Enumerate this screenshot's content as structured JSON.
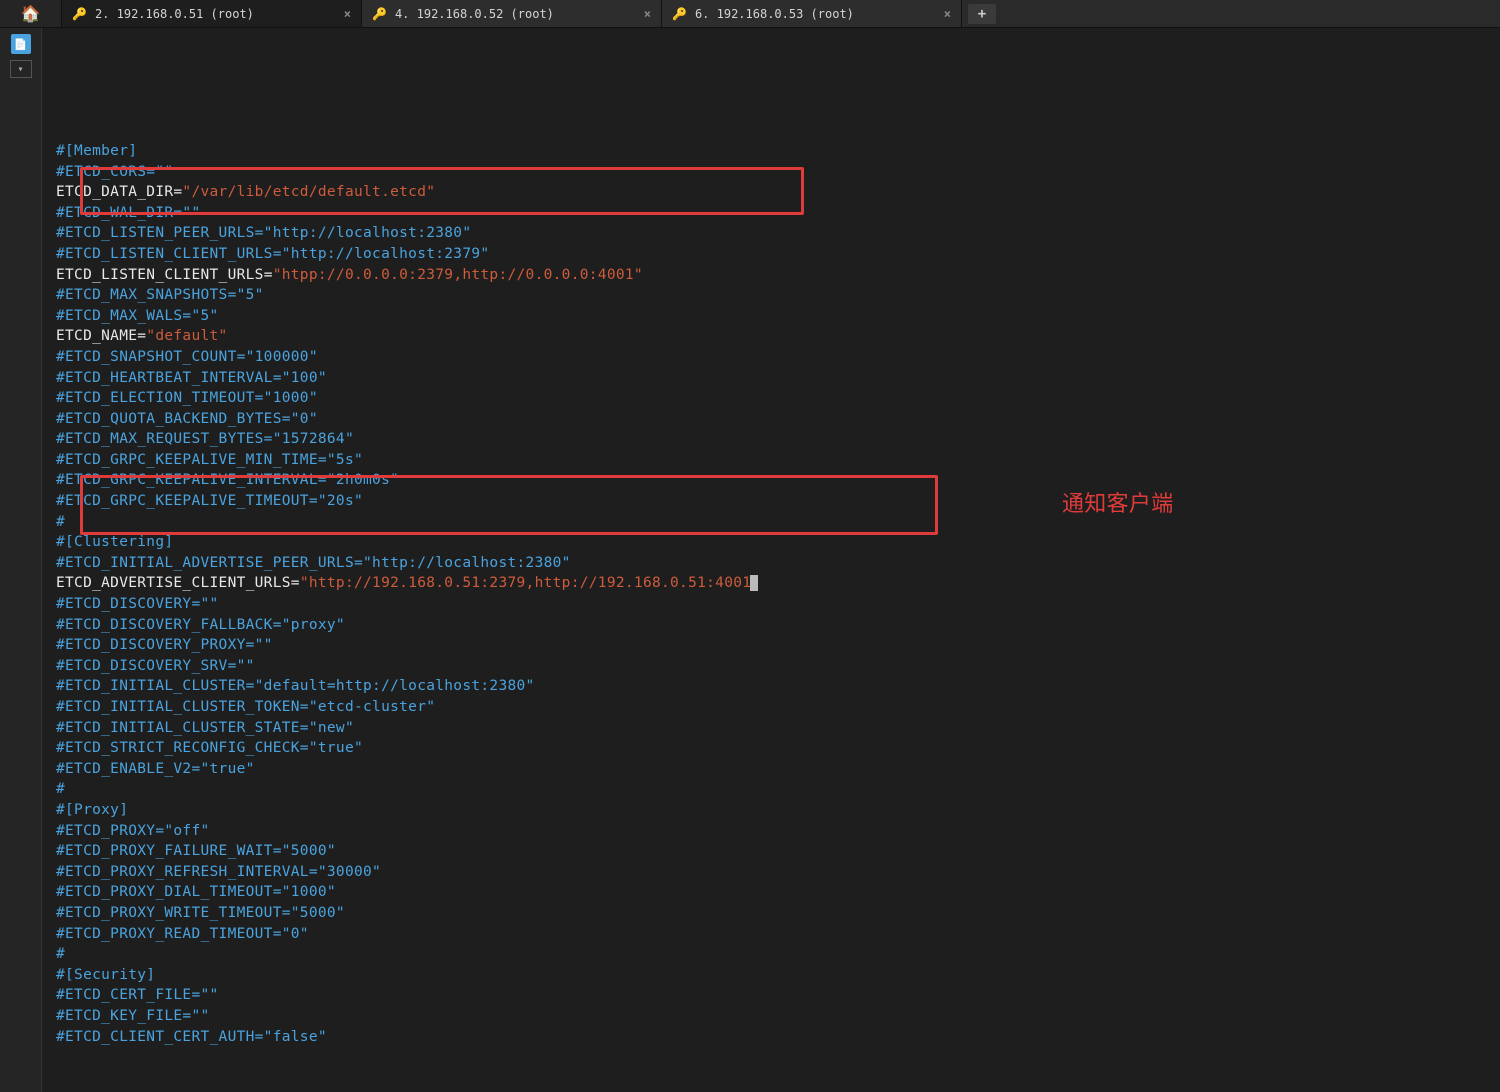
{
  "tabs": [
    {
      "label": "2. 192.168.0.51 (root)",
      "active": true
    },
    {
      "label": "4. 192.168.0.52 (root)",
      "active": false
    },
    {
      "label": "6. 192.168.0.53 (root)",
      "active": false
    }
  ],
  "annotation": "通知客户端",
  "lines": [
    {
      "type": "comment",
      "text": "#[Member]"
    },
    {
      "type": "comment",
      "text": "#ETCD_CORS=\"\""
    },
    {
      "type": "kv",
      "key": "ETCD_DATA_DIR",
      "value": "\"/var/lib/etcd/default.etcd\""
    },
    {
      "type": "comment",
      "text": "#ETCD_WAL_DIR=\"\""
    },
    {
      "type": "comment",
      "text": "#ETCD_LISTEN_PEER_URLS=\"http://localhost:2380\""
    },
    {
      "type": "comment",
      "text": "#ETCD_LISTEN_CLIENT_URLS=\"http://localhost:2379\""
    },
    {
      "type": "kv",
      "key": "ETCD_LISTEN_CLIENT_URLS",
      "value": "\"htpp://0.0.0.0:2379,http://0.0.0.0:4001\""
    },
    {
      "type": "comment",
      "text": "#ETCD_MAX_SNAPSHOTS=\"5\""
    },
    {
      "type": "comment",
      "text": "#ETCD_MAX_WALS=\"5\""
    },
    {
      "type": "kv",
      "key": "ETCD_NAME",
      "value": "\"default\""
    },
    {
      "type": "comment",
      "text": "#ETCD_SNAPSHOT_COUNT=\"100000\""
    },
    {
      "type": "comment",
      "text": "#ETCD_HEARTBEAT_INTERVAL=\"100\""
    },
    {
      "type": "comment",
      "text": "#ETCD_ELECTION_TIMEOUT=\"1000\""
    },
    {
      "type": "comment",
      "text": "#ETCD_QUOTA_BACKEND_BYTES=\"0\""
    },
    {
      "type": "comment",
      "text": "#ETCD_MAX_REQUEST_BYTES=\"1572864\""
    },
    {
      "type": "comment",
      "text": "#ETCD_GRPC_KEEPALIVE_MIN_TIME=\"5s\""
    },
    {
      "type": "comment",
      "text": "#ETCD_GRPC_KEEPALIVE_INTERVAL=\"2h0m0s\""
    },
    {
      "type": "comment",
      "text": "#ETCD_GRPC_KEEPALIVE_TIMEOUT=\"20s\""
    },
    {
      "type": "comment",
      "text": "#"
    },
    {
      "type": "comment",
      "text": "#[Clustering]"
    },
    {
      "type": "comment",
      "text": "#ETCD_INITIAL_ADVERTISE_PEER_URLS=\"http://localhost:2380\""
    },
    {
      "type": "kv_cursor",
      "key": "ETCD_ADVERTISE_CLIENT_URLS",
      "value": "\"http://192.168.0.51:2379,http://192.168.0.51:4001"
    },
    {
      "type": "comment",
      "text": "#ETCD_DISCOVERY=\"\""
    },
    {
      "type": "comment",
      "text": "#ETCD_DISCOVERY_FALLBACK=\"proxy\""
    },
    {
      "type": "comment",
      "text": "#ETCD_DISCOVERY_PROXY=\"\""
    },
    {
      "type": "comment",
      "text": "#ETCD_DISCOVERY_SRV=\"\""
    },
    {
      "type": "comment",
      "text": "#ETCD_INITIAL_CLUSTER=\"default=http://localhost:2380\""
    },
    {
      "type": "comment",
      "text": "#ETCD_INITIAL_CLUSTER_TOKEN=\"etcd-cluster\""
    },
    {
      "type": "comment",
      "text": "#ETCD_INITIAL_CLUSTER_STATE=\"new\""
    },
    {
      "type": "comment",
      "text": "#ETCD_STRICT_RECONFIG_CHECK=\"true\""
    },
    {
      "type": "comment",
      "text": "#ETCD_ENABLE_V2=\"true\""
    },
    {
      "type": "comment",
      "text": "#"
    },
    {
      "type": "comment",
      "text": "#[Proxy]"
    },
    {
      "type": "comment",
      "text": "#ETCD_PROXY=\"off\""
    },
    {
      "type": "comment",
      "text": "#ETCD_PROXY_FAILURE_WAIT=\"5000\""
    },
    {
      "type": "comment",
      "text": "#ETCD_PROXY_REFRESH_INTERVAL=\"30000\""
    },
    {
      "type": "comment",
      "text": "#ETCD_PROXY_DIAL_TIMEOUT=\"1000\""
    },
    {
      "type": "comment",
      "text": "#ETCD_PROXY_WRITE_TIMEOUT=\"5000\""
    },
    {
      "type": "comment",
      "text": "#ETCD_PROXY_READ_TIMEOUT=\"0\""
    },
    {
      "type": "comment",
      "text": "#"
    },
    {
      "type": "comment",
      "text": "#[Security]"
    },
    {
      "type": "comment",
      "text": "#ETCD_CERT_FILE=\"\""
    },
    {
      "type": "comment",
      "text": "#ETCD_KEY_FILE=\"\""
    },
    {
      "type": "comment",
      "text": "#ETCD_CLIENT_CERT_AUTH=\"false\""
    }
  ]
}
